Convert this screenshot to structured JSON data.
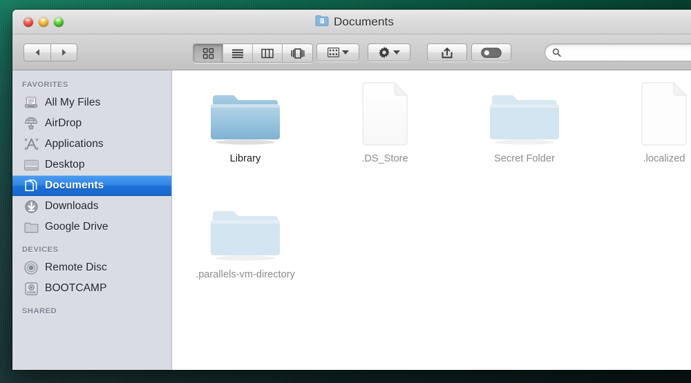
{
  "window": {
    "title": "Documents",
    "title_icon": "documents-folder-icon",
    "traffic_lights": [
      {
        "name": "close-button",
        "color": "#f75b50"
      },
      {
        "name": "minimize-button",
        "color": "#f7bc3e"
      },
      {
        "name": "zoom-button",
        "color": "#5fd236"
      }
    ]
  },
  "toolbar": {
    "back_label": "◀",
    "forward_label": "▶",
    "view_modes": [
      {
        "name": "icon-view",
        "icon": "grid-icon",
        "active": true
      },
      {
        "name": "list-view",
        "icon": "list-icon",
        "active": false
      },
      {
        "name": "column-view",
        "icon": "columns-icon",
        "active": false
      },
      {
        "name": "coverflow-view",
        "icon": "coverflow-icon",
        "active": false
      }
    ],
    "arrange_button": {
      "name": "arrange-button",
      "icon": "arrange-grid-icon"
    },
    "action_button": {
      "name": "action-button",
      "icon": "gear-icon"
    },
    "share_button": {
      "name": "share-button",
      "icon": "share-icon"
    },
    "tags_button": {
      "name": "tags-button",
      "icon": "tag-pill-icon"
    },
    "search": {
      "placeholder": "",
      "value": "",
      "icon": "search-icon"
    }
  },
  "sidebar": {
    "sections": [
      {
        "header": "FAVORITES",
        "items": [
          {
            "label": "All My Files",
            "icon": "all-my-files-icon",
            "selected": false
          },
          {
            "label": "AirDrop",
            "icon": "airdrop-icon",
            "selected": false
          },
          {
            "label": "Applications",
            "icon": "applications-icon",
            "selected": false
          },
          {
            "label": "Desktop",
            "icon": "desktop-icon",
            "selected": false
          },
          {
            "label": "Documents",
            "icon": "documents-icon",
            "selected": true
          },
          {
            "label": "Downloads",
            "icon": "downloads-icon",
            "selected": false
          },
          {
            "label": "Google Drive",
            "icon": "folder-icon",
            "selected": false
          }
        ]
      },
      {
        "header": "DEVICES",
        "items": [
          {
            "label": "Remote Disc",
            "icon": "optical-disc-icon",
            "selected": false
          },
          {
            "label": "BOOTCAMP",
            "icon": "hard-drive-icon",
            "selected": false
          }
        ]
      },
      {
        "header": "SHARED",
        "items": []
      }
    ]
  },
  "content": {
    "items": [
      {
        "label": "Library",
        "type": "folder",
        "hidden": false
      },
      {
        "label": ".DS_Store",
        "type": "document",
        "hidden": true
      },
      {
        "label": "Secret Folder",
        "type": "folder",
        "hidden": true
      },
      {
        "label": ".localized",
        "type": "document",
        "hidden": true
      },
      {
        "label": ".parallels-vm-directory",
        "type": "folder",
        "hidden": true
      }
    ]
  },
  "colors": {
    "selection_blue": "#2f85e6",
    "folder_blue": "#8cbcd9",
    "sidebar_bg": "#d9dde3",
    "desktop_green": "#0d5244"
  }
}
